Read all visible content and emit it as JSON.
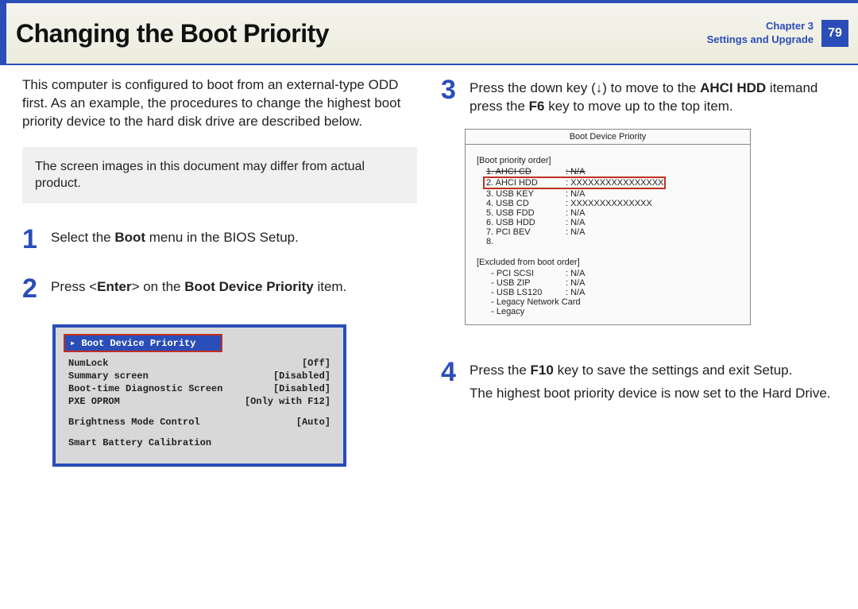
{
  "header": {
    "title": "Changing the Boot Priority",
    "chapter_line1": "Chapter 3",
    "chapter_line2": "Settings and Upgrade",
    "page_number": "79"
  },
  "intro": "This computer is configured to boot from an external-type ODD first. As an example, the procedures to change the highest boot priority device to the hard disk drive are described below.",
  "note": "The screen images in this document may differ from actual product.",
  "steps": {
    "s1_pre": "Select the ",
    "s1_b1": "Boot",
    "s1_post": " menu in the BIOS Setup.",
    "s2_pre": "Press <",
    "s2_b1": "Enter",
    "s2_mid": "> on the ",
    "s2_b2": "Boot Device Priority",
    "s2_post": " item.",
    "s3_pre": "Press the down key (↓) to move to the ",
    "s3_b1": "AHCI HDD",
    "s3_mid": " itemand press the ",
    "s3_b2": "F6",
    "s3_post": " key to move up to the top item.",
    "s4_pre": "Press the ",
    "s4_b1": "F10",
    "s4_post": " key to save the settings and exit Setup.",
    "s4_line2": "The highest boot priority device is now set to the Hard Drive."
  },
  "bios1": {
    "highlight_label": "Boot Device Priority",
    "rows": [
      {
        "label": "NumLock",
        "value": "[Off]"
      },
      {
        "label": "Summary screen",
        "value": "[Disabled]"
      },
      {
        "label": "Boot-time Diagnostic Screen",
        "value": "[Disabled]"
      },
      {
        "label": "PXE OPROM",
        "value": "[Only with F12]"
      }
    ],
    "row_bmc": {
      "label": "Brightness Mode Control",
      "value": "[Auto]"
    },
    "row_sbc": {
      "label": "Smart Battery Calibration",
      "value": ""
    }
  },
  "bios2": {
    "title": "Boot Device Priority",
    "section1_label": "[Boot priority order]",
    "order": [
      {
        "n": "1. AHCI CD",
        "v": ": N/A",
        "strike": true
      },
      {
        "n": "2. AHCI HDD",
        "v": ": XXXXXXXXXXXXXXXX",
        "hl": true
      },
      {
        "n": "3. USB KEY",
        "v": ": N/A"
      },
      {
        "n": "4. USB CD",
        "v": ": XXXXXXXXXXXXXX"
      },
      {
        "n": "5. USB FDD",
        "v": ": N/A"
      },
      {
        "n": "6. USB HDD",
        "v": ": N/A"
      },
      {
        "n": "7. PCI BEV",
        "v": ": N/A"
      },
      {
        "n": "8.",
        "v": ""
      }
    ],
    "section2_label": "[Excluded from boot order]",
    "excluded": [
      {
        "n": "  - PCI SCSI",
        "v": ": N/A"
      },
      {
        "n": "  - USB ZIP",
        "v": ": N/A"
      },
      {
        "n": "  - USB LS120",
        "v": ": N/A"
      },
      {
        "n": "  - Legacy Network Card",
        "v": ""
      },
      {
        "n": "  - Legacy",
        "v": ""
      }
    ]
  }
}
